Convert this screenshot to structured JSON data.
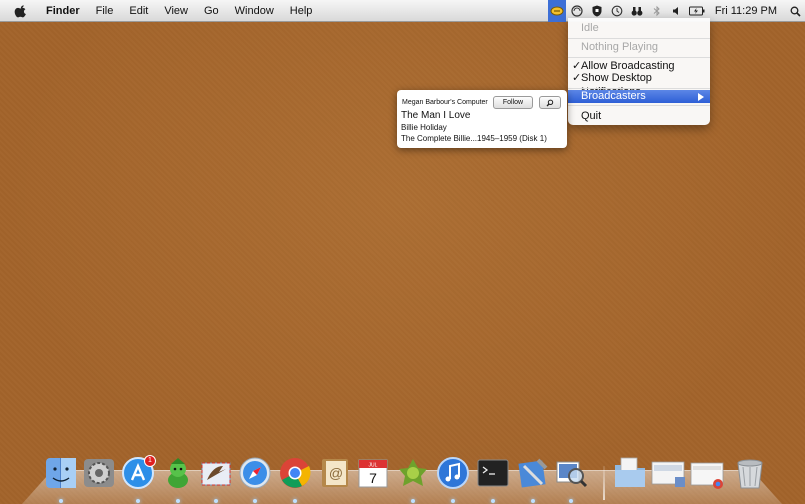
{
  "menubar": {
    "app_name": "Finder",
    "menus": [
      "File",
      "Edit",
      "View",
      "Go",
      "Window",
      "Help"
    ],
    "clock": "Fri 11:29 PM",
    "status_icons": [
      "broadcast-icon",
      "sync-icon",
      "shield-icon",
      "time-machine-icon",
      "binoculars-icon",
      "bluetooth-icon",
      "volume-icon",
      "battery-icon"
    ]
  },
  "dropdown": {
    "status_idle": "Idle",
    "nothing_playing": "Nothing Playing",
    "allow_broadcasting": "Allow Broadcasting",
    "show_notifications": "Show Desktop Notifications",
    "check_mark": "✓",
    "broadcasters": "Broadcasters",
    "quit": "Quit"
  },
  "popup": {
    "computer_name": "Megan Barbour's Computer",
    "follow_label": "Follow",
    "song_title": "The Man I Love",
    "artist": "Billie Holiday",
    "album": "The Complete Billie...1945–1959 (Disk 1)"
  },
  "dock": {
    "app_store_badge": "1",
    "calendar_day": "7",
    "calendar_month": "JUL",
    "apps": [
      "finder",
      "system-preferences",
      "app-store",
      "adium",
      "mail",
      "safari",
      "chrome",
      "address-book",
      "calendar",
      "growl",
      "itunes",
      "terminal",
      "xcode",
      "preview",
      "documents-folder",
      "downloads-stack",
      "screenshots-stack",
      "trash"
    ]
  },
  "colors": {
    "desktop": "#a3642b",
    "highlight": "#3d6fd6"
  }
}
